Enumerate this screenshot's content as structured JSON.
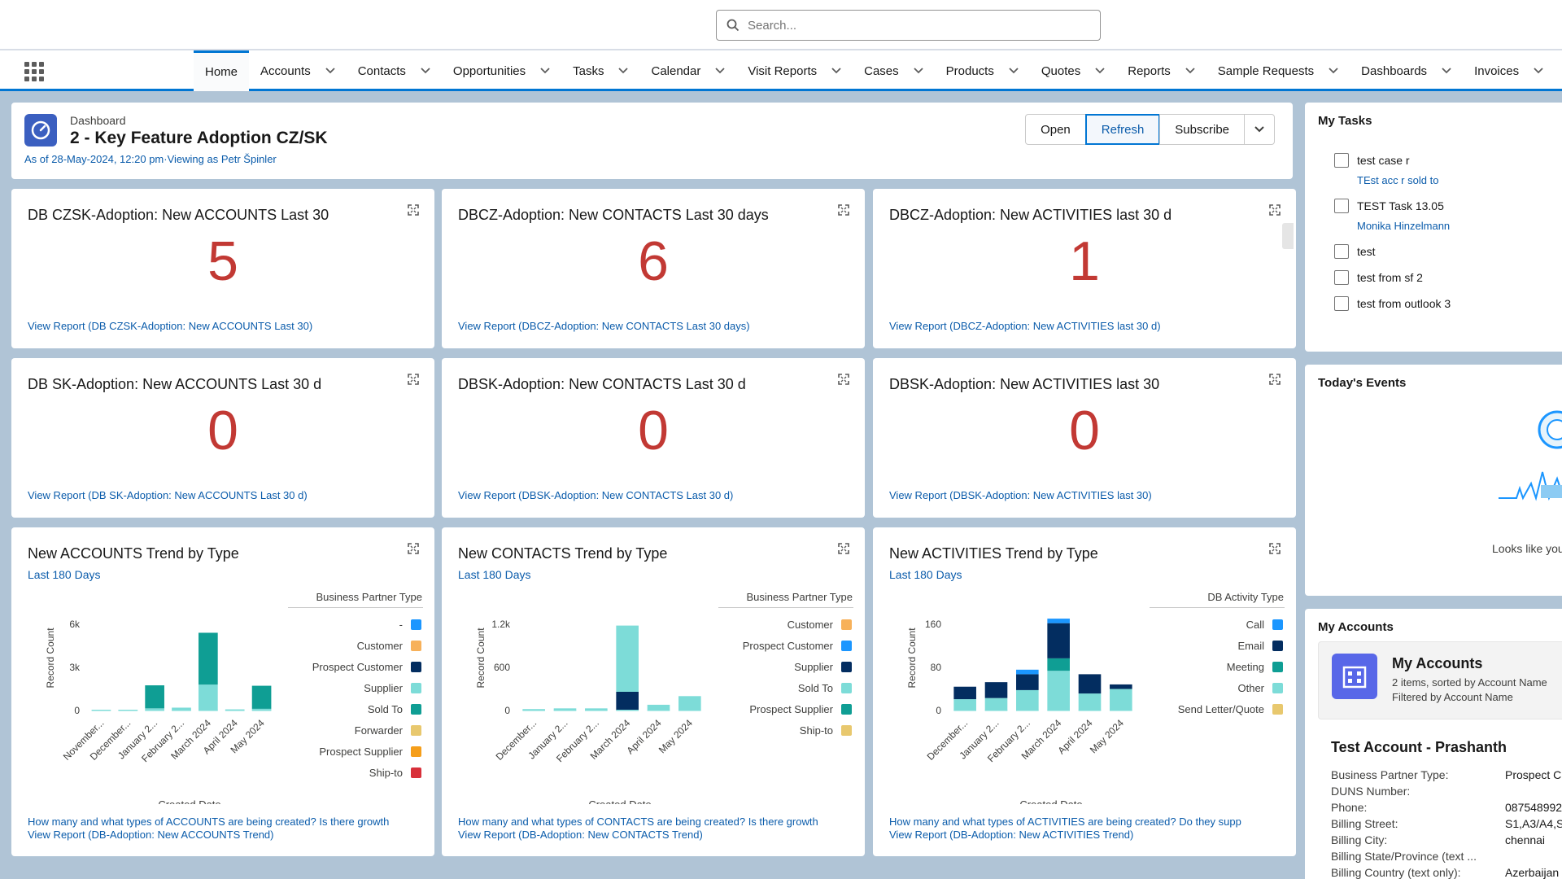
{
  "search": {
    "placeholder": "Search..."
  },
  "nav": {
    "items": [
      {
        "label": "Home",
        "active": true,
        "menu": false
      },
      {
        "label": "Accounts",
        "menu": true
      },
      {
        "label": "Contacts",
        "menu": true
      },
      {
        "label": "Opportunities",
        "menu": true
      },
      {
        "label": "Tasks",
        "menu": true
      },
      {
        "label": "Calendar",
        "menu": true
      },
      {
        "label": "Visit Reports",
        "menu": true
      },
      {
        "label": "Cases",
        "menu": true
      },
      {
        "label": "Products",
        "menu": true
      },
      {
        "label": "Quotes",
        "menu": true
      },
      {
        "label": "Reports",
        "menu": true
      },
      {
        "label": "Sample Requests",
        "menu": true
      },
      {
        "label": "Dashboards",
        "menu": true
      },
      {
        "label": "Invoices",
        "menu": true
      }
    ]
  },
  "dashboard": {
    "kicker": "Dashboard",
    "title": "2 - Key Feature Adoption CZ/SK",
    "subtitle": "As of 28-May-2024, 12:20 pm·Viewing as Petr Špinler",
    "buttons": {
      "open": "Open",
      "refresh": "Refresh",
      "subscribe": "Subscribe"
    }
  },
  "metrics": [
    {
      "title": "DB CZSK-Adoption: New ACCOUNTS Last 30",
      "value": "5",
      "link": "View Report (DB CZSK-Adoption: New ACCOUNTS Last 30)"
    },
    {
      "title": "DBCZ-Adoption: New CONTACTS Last 30 days",
      "value": "6",
      "link": "View Report (DBCZ-Adoption: New CONTACTS Last 30 days)"
    },
    {
      "title": "DBCZ-Adoption: New ACTIVITIES last 30 d",
      "value": "1",
      "link": "View Report (DBCZ-Adoption: New ACTIVITIES last 30 d)"
    },
    {
      "title": "DB SK-Adoption: New ACCOUNTS Last 30 d",
      "value": "0",
      "link": "View Report (DB SK-Adoption: New ACCOUNTS Last 30 d)"
    },
    {
      "title": "DBSK-Adoption: New CONTACTS Last 30 d",
      "value": "0",
      "link": "View Report (DBSK-Adoption: New CONTACTS Last 30 d)"
    },
    {
      "title": "DBSK-Adoption: New ACTIVITIES last 30",
      "value": "0",
      "link": "View Report (DBSK-Adoption: New ACTIVITIES last 30)"
    }
  ],
  "chart_data": [
    {
      "type": "bar",
      "stacked": true,
      "title": "New ACCOUNTS Trend by Type",
      "subtitle": "Last 180 Days",
      "xlabel": "Created Date",
      "ylabel": "Record Count",
      "yticks": [
        "0",
        "3k",
        "6k"
      ],
      "ylim": [
        0,
        6500
      ],
      "categories": [
        "November...",
        "December...",
        "January 2...",
        "February 2...",
        "March 2024",
        "April 2024",
        "May 2024"
      ],
      "legend_title": "Business Partner Type",
      "series": [
        {
          "name": "-",
          "color": "#1b96ff",
          "values": [
            0,
            0,
            0,
            0,
            0,
            0,
            0
          ]
        },
        {
          "name": "Customer",
          "color": "#f7b15a",
          "values": [
            0,
            0,
            0,
            0,
            0,
            0,
            0
          ]
        },
        {
          "name": "Prospect Customer",
          "color": "#032d60",
          "values": [
            0,
            0,
            0,
            0,
            0,
            0,
            0
          ]
        },
        {
          "name": "Supplier",
          "color": "#7ddcd8",
          "values": [
            0,
            0,
            150,
            200,
            1800,
            80,
            120
          ]
        },
        {
          "name": "Sold To",
          "color": "#0f9e94",
          "values": [
            0,
            50,
            1600,
            0,
            3600,
            0,
            1600
          ]
        },
        {
          "name": "Forwarder",
          "color": "#e8c86e",
          "values": [
            0,
            0,
            0,
            0,
            0,
            0,
            0
          ]
        },
        {
          "name": "Prospect Supplier",
          "color": "#f59e1a",
          "values": [
            0,
            0,
            0,
            0,
            0,
            0,
            0
          ]
        },
        {
          "name": "Ship-to",
          "color": "#d8303a",
          "values": [
            0,
            0,
            0,
            0,
            0,
            0,
            0
          ]
        }
      ],
      "footer_question": "How many and what types of ACCOUNTS are being created? Is there growth",
      "footer_link": "View Report (DB-Adoption: New ACCOUNTS Trend)"
    },
    {
      "type": "bar",
      "stacked": true,
      "title": "New CONTACTS Trend by Type",
      "subtitle": "Last 180 Days",
      "xlabel": "Created Date",
      "ylabel": "Record Count",
      "yticks": [
        "0",
        "600",
        "1.2k"
      ],
      "ylim": [
        0,
        1300
      ],
      "categories": [
        "December...",
        "January 2...",
        "February 2...",
        "March 2024",
        "April 2024",
        "May 2024"
      ],
      "legend_title": "Business Partner Type",
      "series": [
        {
          "name": "Customer",
          "color": "#f7b15a",
          "values": [
            0,
            0,
            0,
            0,
            0,
            0
          ]
        },
        {
          "name": "Prospect Customer",
          "color": "#1b96ff",
          "values": [
            0,
            0,
            0,
            0,
            0,
            0
          ]
        },
        {
          "name": "Supplier",
          "color": "#032d60",
          "values": [
            0,
            0,
            0,
            260,
            0,
            0
          ]
        },
        {
          "name": "Sold To",
          "color": "#7ddcd8",
          "values": [
            20,
            30,
            30,
            920,
            80,
            200
          ]
        },
        {
          "name": "Prospect Supplier",
          "color": "#0f9e94",
          "values": [
            0,
            0,
            0,
            0,
            0,
            0
          ]
        },
        {
          "name": "Ship-to",
          "color": "#e8c86e",
          "values": [
            0,
            0,
            0,
            0,
            0,
            0
          ]
        }
      ],
      "footer_question": "How many and what types of CONTACTS are being created? Is there growth",
      "footer_link": "View Report (DB-Adoption: New CONTACTS Trend)"
    },
    {
      "type": "bar",
      "stacked": true,
      "title": "New ACTIVITIES Trend by Type",
      "subtitle": "Last 180 Days",
      "xlabel": "Created Date",
      "ylabel": "Record Count",
      "yticks": [
        "0",
        "80",
        "160"
      ],
      "ylim": [
        0,
        165
      ],
      "categories": [
        "December...",
        "January 2...",
        "February 2...",
        "March 2024",
        "April 2024",
        "May 2024"
      ],
      "legend_title": "DB Activity Type",
      "series": [
        {
          "name": "Other",
          "color": "#7ddcd8",
          "values": [
            20,
            22,
            36,
            70,
            30,
            38
          ]
        },
        {
          "name": "Meeting",
          "color": "#0f9e94",
          "values": [
            0,
            0,
            0,
            22,
            0,
            0
          ]
        },
        {
          "name": "Email",
          "color": "#032d60",
          "values": [
            22,
            28,
            28,
            62,
            34,
            8
          ]
        },
        {
          "name": "Call",
          "color": "#1b96ff",
          "values": [
            0,
            0,
            8,
            8,
            0,
            0
          ]
        },
        {
          "name": "Send Letter/Quote",
          "color": "#e8c86e",
          "values": [
            0,
            0,
            0,
            0,
            0,
            0
          ]
        }
      ],
      "legend_order": [
        "Call",
        "Email",
        "Meeting",
        "Other",
        "Send Letter/Quote"
      ],
      "footer_question": "How many and what types of ACTIVITIES are being created? Do they supp",
      "footer_link": "View Report (DB-Adoption: New ACTIVITIES Trend)"
    }
  ],
  "my_tasks": {
    "title": "My Tasks",
    "items": [
      {
        "label": "test case r",
        "sub": "TEst acc r sold to"
      },
      {
        "label": "TEST Task 13.05",
        "sub": "Monika Hinzelmann"
      },
      {
        "label": "test",
        "sub": ""
      },
      {
        "label": "test from sf 2",
        "sub": ""
      },
      {
        "label": "test from outlook 3",
        "sub": ""
      }
    ]
  },
  "todays_events": {
    "title": "Today's Events",
    "empty_text": "Looks like you'"
  },
  "my_accounts": {
    "title": "My Accounts",
    "card_title": "My Accounts",
    "card_meta1": "2 items, sorted by Account Name",
    "card_meta2": "Filtered by Account Name",
    "account_name": "Test Account - Prashanth",
    "fields": [
      {
        "label": "Business Partner Type:",
        "value": "Prospect C"
      },
      {
        "label": "DUNS Number:",
        "value": ""
      },
      {
        "label": "Phone:",
        "value": "087548992"
      },
      {
        "label": "Billing Street:",
        "value": "S1,A3/A4,S"
      },
      {
        "label": "Billing City:",
        "value": "chennai"
      },
      {
        "label": "Billing State/Province (text ...",
        "value": ""
      },
      {
        "label": "Billing Country (text only):",
        "value": "Azerbaijan"
      }
    ]
  },
  "colors": {
    "accent": "#0176d3",
    "metric": "#c23934",
    "link": "#0b5cab",
    "background": "#b0c4d6"
  }
}
